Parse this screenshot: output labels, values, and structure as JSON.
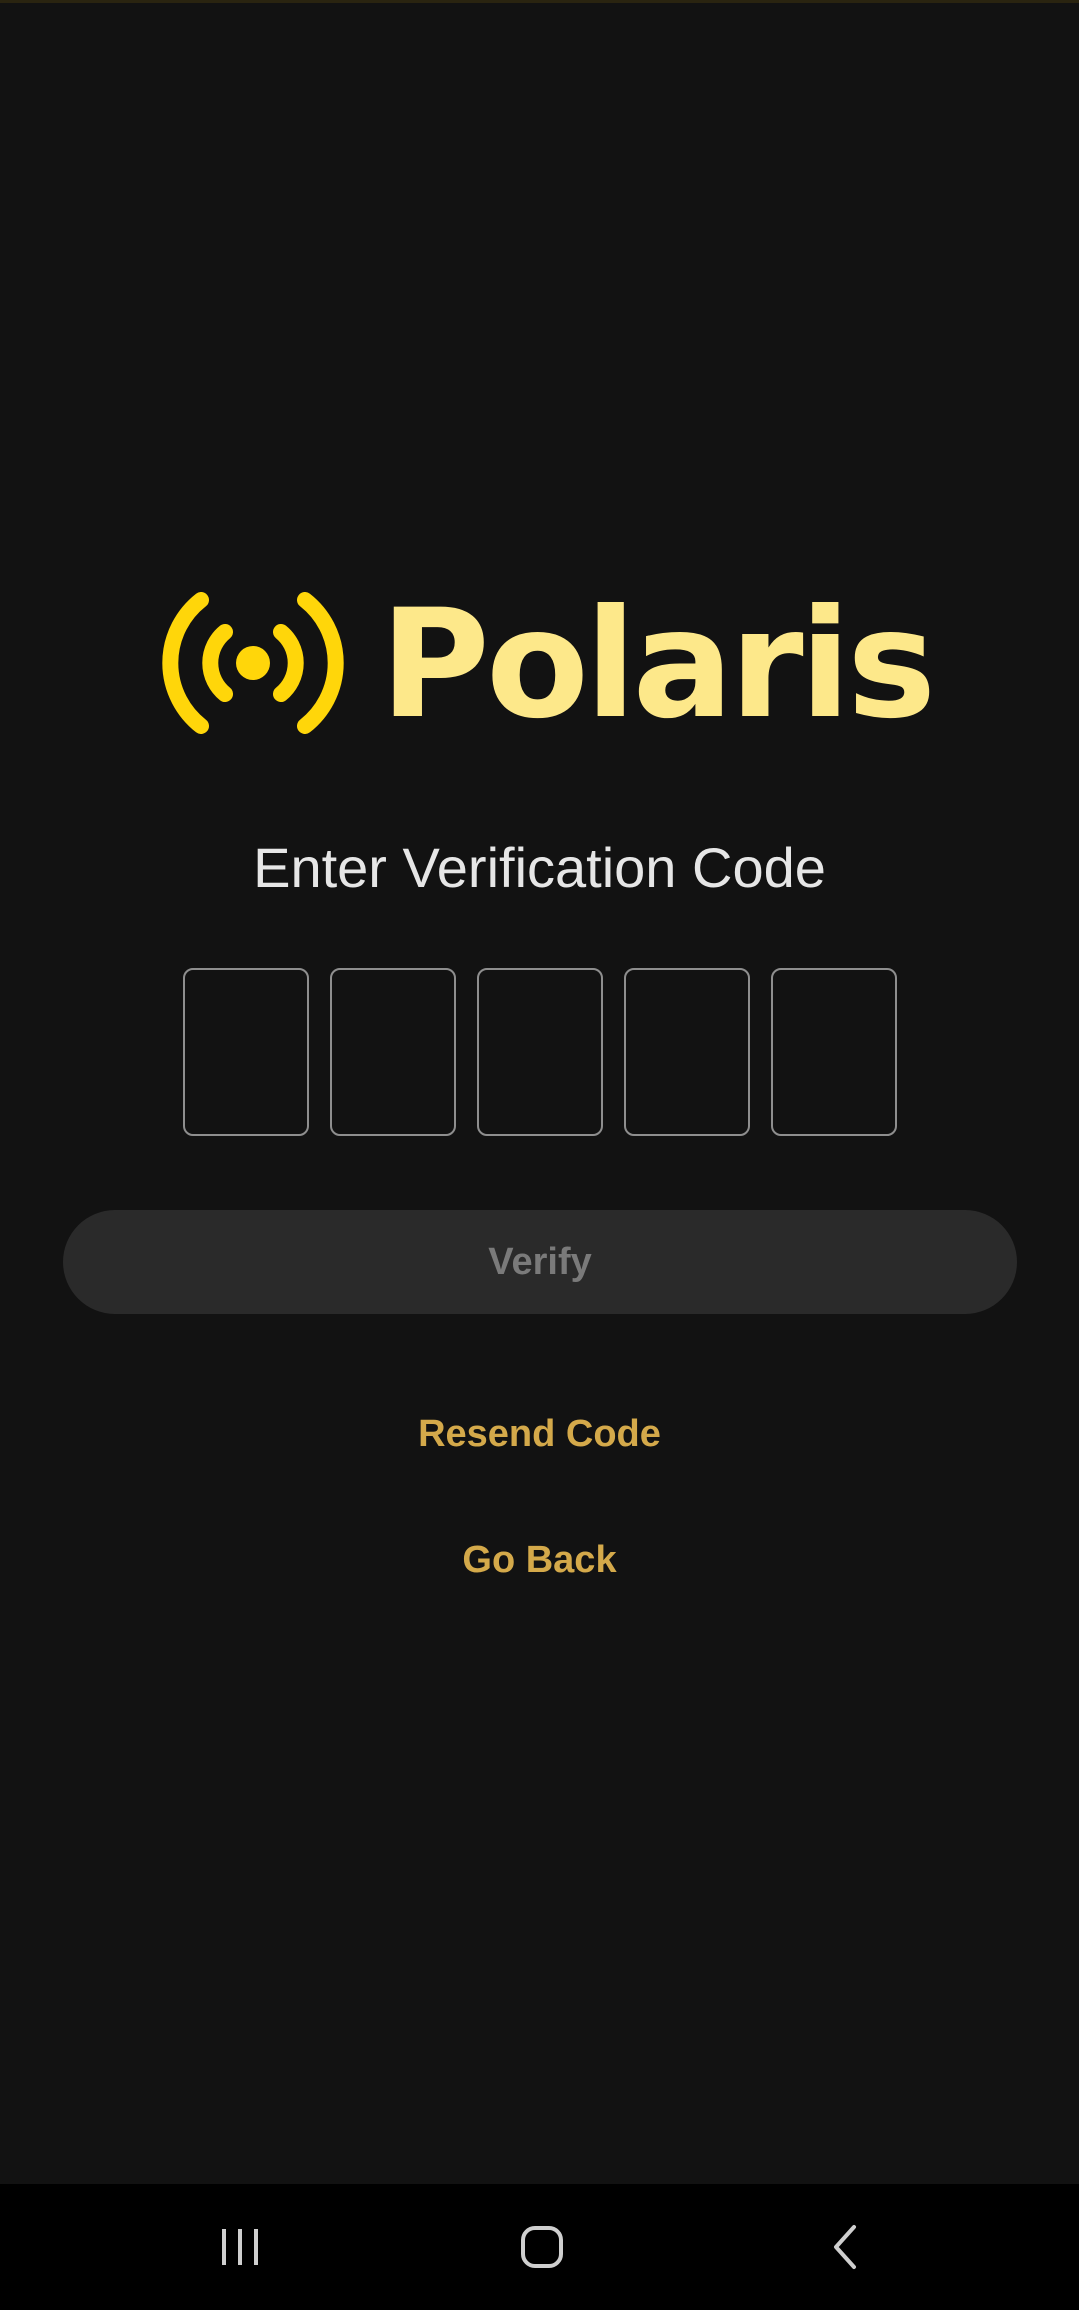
{
  "brand": {
    "name": "Polaris",
    "icon": "broadcast-signal-icon",
    "icon_color": "#ffd60a",
    "name_color": "#fde88a"
  },
  "heading": "Enter Verification Code",
  "code_inputs": [
    {
      "value": "",
      "label": "digit-1"
    },
    {
      "value": "",
      "label": "digit-2"
    },
    {
      "value": "",
      "label": "digit-3"
    },
    {
      "value": "",
      "label": "digit-4"
    },
    {
      "value": "",
      "label": "digit-5"
    }
  ],
  "actions": {
    "verify_label": "Verify",
    "resend_label": "Resend Code",
    "go_back_label": "Go Back"
  },
  "colors": {
    "background": "#121212",
    "link": "#d4a94a",
    "button_bg": "#2a2a2a",
    "button_text_disabled": "#7a7a7a"
  },
  "system_nav": {
    "recents": "recents-icon",
    "home": "home-icon",
    "back": "back-icon"
  }
}
